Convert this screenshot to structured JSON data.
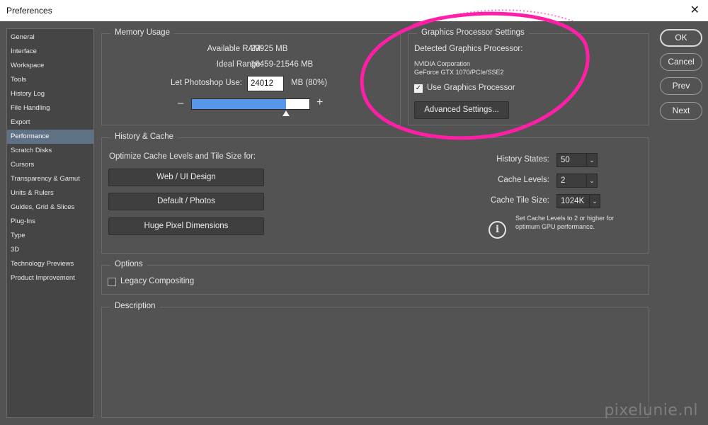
{
  "window": {
    "title": "Preferences",
    "close": "✕"
  },
  "sidebar": {
    "items": [
      {
        "label": "General"
      },
      {
        "label": "Interface"
      },
      {
        "label": "Workspace"
      },
      {
        "label": "Tools"
      },
      {
        "label": "History Log"
      },
      {
        "label": "File Handling"
      },
      {
        "label": "Export"
      },
      {
        "label": "Performance",
        "active": true
      },
      {
        "label": "Scratch Disks"
      },
      {
        "label": "Cursors"
      },
      {
        "label": "Transparency & Gamut"
      },
      {
        "label": "Units & Rulers"
      },
      {
        "label": "Guides, Grid & Slices"
      },
      {
        "label": "Plug-Ins"
      },
      {
        "label": "Type"
      },
      {
        "label": "3D"
      },
      {
        "label": "Technology Previews"
      },
      {
        "label": "Product Improvement"
      }
    ]
  },
  "memory": {
    "title": "Memory Usage",
    "available_label": "Available RAM:",
    "available_value": "29925 MB",
    "ideal_label": "Ideal Range:",
    "ideal_value": "16459-21546 MB",
    "let_label": "Let Photoshop Use:",
    "let_value": "24012",
    "let_suffix": "MB (80%)",
    "minus": "–",
    "plus": "+",
    "slider_fraction": 0.8
  },
  "gpu": {
    "title": "Graphics Processor Settings",
    "detected_label": "Detected Graphics Processor:",
    "vendor": "NVIDIA Corporation",
    "model": "GeForce GTX 1070/PCIe/SSE2",
    "use_label": "Use Graphics Processor",
    "use_checked": true,
    "check_mark": "✓",
    "advanced_label": "Advanced Settings..."
  },
  "buttons": {
    "ok": "OK",
    "cancel": "Cancel",
    "prev": "Prev",
    "next": "Next"
  },
  "history": {
    "title": "History & Cache",
    "optimize_label": "Optimize Cache Levels and Tile Size for:",
    "preset_web": "Web / UI Design",
    "preset_default": "Default / Photos",
    "preset_huge": "Huge Pixel Dimensions",
    "states_label": "History States:",
    "states_value": "50",
    "levels_label": "Cache Levels:",
    "levels_value": "2",
    "tile_label": "Cache Tile Size:",
    "tile_value": "1024K",
    "caret": "⌄",
    "note_line1": "Set Cache Levels to 2 or higher for",
    "note_line2": "optimum GPU performance.",
    "info_glyph": "i"
  },
  "options": {
    "title": "Options",
    "legacy_label": "Legacy Compositing",
    "legacy_checked": false
  },
  "description": {
    "title": "Description"
  },
  "watermark": "pixelunie.nl",
  "colors": {
    "background": "#535353",
    "sidebar_active": "#5e7185",
    "slider_fill": "#5896ea",
    "annotation": "#ff1fa6"
  }
}
